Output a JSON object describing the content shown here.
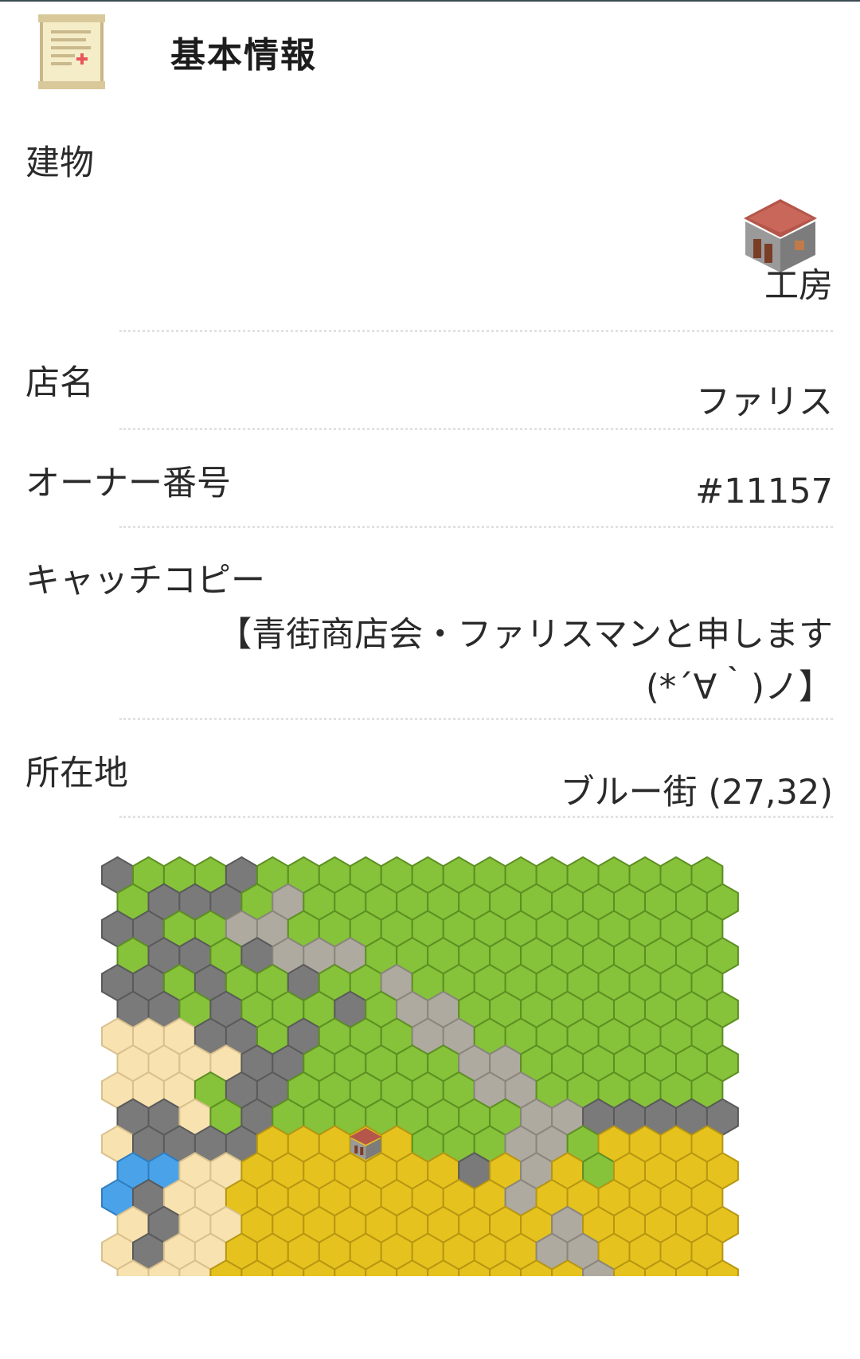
{
  "header": {
    "title": "基本情報",
    "icon": "scroll-icon"
  },
  "info": {
    "building_label": "建物",
    "building_value": "工房",
    "building_icon": "workshop-house-icon",
    "shop_name_label": "店名",
    "shop_name_value": "ファリス",
    "owner_label": "オーナー番号",
    "owner_value": "#11157",
    "catchcopy_label": "キャッチコピー",
    "catchcopy_line1": "【青街商店会・ファリスマンと申します",
    "catchcopy_line2": "(*´∀｀)ノ】",
    "location_label": "所在地",
    "location_value": "ブルー街 (27,32)"
  },
  "map": {
    "terrain_legend": {
      "G": "grass",
      "R": "road",
      "S": "stone",
      "D": "sand",
      "W": "water",
      "F": "field",
      "H": "house"
    },
    "grid": [
      "SGGGSGGGGGGGGGGGGGGG",
      "GSSSGRGGGGGGGGGGGGGG",
      "SSGGRRGGGGGGGGGGGGGG",
      "GSSGSRRRGGGGGGGGGGGG",
      "SSGSGGSGGRGGGGGGGGGG",
      "SSGSGGGSGRRGGGGGGGGG",
      "DDDSSGSGGGRRGGGGGGGG",
      "DDDDSSGGGGGRRGGGGGGG",
      "DDDGSSGGGGGGRRGGGGGG",
      "SSDGSGGGGGGGGRRSSSSS",
      "DSSSSFFFHFGGGRRGFFFF",
      "WWDDFFFFFFFSFRFGFFFF",
      "WSDDFFFFFFFFFRFFFFFF",
      "DSDDFFFFFFFFFFRFFFFF",
      "DSDDFFFFFFFFFFRRFFFF",
      "DDDFFFFFFFFFFFFRFFFF",
      "WWDDFFFFFFFFFFFRFFFF",
      "WWWDDDDFFFFFFFFFFFFF"
    ]
  }
}
